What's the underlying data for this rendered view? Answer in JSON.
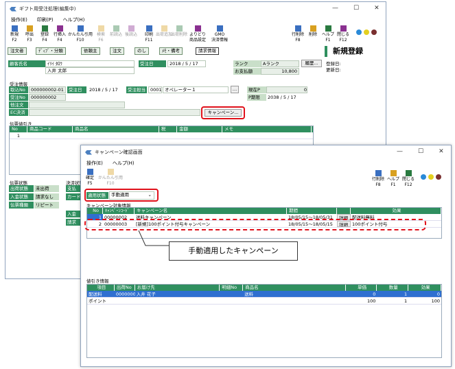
{
  "main": {
    "title": "ギフト用受注処理(編集中)",
    "menu": [
      "操作(E)",
      "印刷(P)",
      "ヘルプ(H)"
    ],
    "toolbar": [
      {
        "label": "新規",
        "key": "F2",
        "icon": "new-icon"
      },
      {
        "label": "呼出",
        "key": "F3",
        "icon": "open-icon"
      },
      {
        "label": "登録",
        "key": "F4",
        "icon": "save-icon"
      },
      {
        "label": "行挿入",
        "key": "F4",
        "icon": "row-insert-icon"
      },
      {
        "label": "かんたん引用",
        "key": "F10",
        "icon": "quote-icon"
      },
      {
        "label": "検索",
        "key": "F6",
        "icon": "search-icon"
      },
      {
        "label": "前読込",
        "key": "",
        "icon": "prev-icon"
      },
      {
        "label": "後読込",
        "key": "",
        "icon": "next-icon"
      },
      {
        "label": "印刷",
        "key": "F11",
        "icon": "print-icon"
      },
      {
        "label": "出荷追加",
        "key": "",
        "icon": "ship-add-icon"
      },
      {
        "label": "出荷削除",
        "key": "",
        "icon": "ship-delete-icon"
      },
      {
        "label": "よりどり",
        "key": "商品設定",
        "icon": "yoridori-icon"
      },
      {
        "label": "GMO",
        "key": "決済情報",
        "icon": "gmo-icon"
      }
    ],
    "toolbar_right": [
      {
        "label": "行削除",
        "key": "F8"
      },
      {
        "label": "削除",
        "key": ""
      },
      {
        "label": "ヘルプ",
        "key": "F1"
      },
      {
        "label": "閉じる",
        "key": "F12"
      }
    ],
    "tabs": [
      "注文者",
      "ﾃﾞｨﾌﾞ・分類",
      "依頼主",
      "注文",
      "のし",
      "ﾒﾓ・備考",
      "請求情報"
    ],
    "mode": "新規登録",
    "reg_date_label": "登録日:",
    "upd_date_label": "更新日:",
    "customer_label": "顧客氏名",
    "customer_kana": "ｲﾘｲ ﾀﾛｳ",
    "customer_name": "入井 太郎",
    "order_date_label": "受注日",
    "order_date": "2018 / 5 / 17",
    "rank_label": "ランク",
    "rank_value": "Aランク",
    "history_btn": "履歴...",
    "paid_label": "お支払額",
    "paid_value": "10,800",
    "section_order": "受注情報",
    "order_no_label": "取込No",
    "order_no": "000000002-01",
    "order_date2_label": "受注日",
    "order_date2": "2018 / 5 / 17",
    "staff_label": "受注担当",
    "staff_code": "0001",
    "staff_name": "オペレーター１",
    "current_p_label": "現在P",
    "current_p": "0",
    "order_no2_label": "受注No",
    "order_no2": "000000002",
    "p_expire_label": "P期限",
    "p_expire": "2038 / 5 / 17",
    "other_order_label": "他注文",
    "ec_label": "EC決済",
    "campaign_btn": "キャンペーン...",
    "section_slip": "伝票値引き",
    "slip_cols": [
      "No",
      "商品コード",
      "商品名",
      "税",
      "金額",
      "メモ"
    ],
    "slip_row1_no": "1",
    "status_left": [
      "伝票状態",
      "出荷状態",
      "入金状態",
      "伝票種類"
    ],
    "status_vals": [
      "未出荷",
      "請求なし",
      "リピート"
    ],
    "payment_label": "決済状態",
    "payment_items": [
      "支払",
      "カード",
      "入金",
      "請求"
    ]
  },
  "dialog": {
    "title": "キャンペーン確認画面",
    "menu": [
      "操作(E)",
      "ヘルプ(H)"
    ],
    "toolbar": [
      {
        "label": "確定",
        "key": "F5"
      },
      {
        "label": "かんたん引用",
        "key": "F10"
      }
    ],
    "toolbar_right": [
      {
        "label": "行削除",
        "key": "F8"
      },
      {
        "label": "ヘルプ",
        "key": "F1"
      },
      {
        "label": "閉じる",
        "key": "F12"
      }
    ],
    "apply_label": "適用状態",
    "apply_value": "手動適用",
    "campaign_section": "キャンペーン対象情報",
    "campaign_cols": [
      "No",
      "ｷｬﾝﾍﾟｰﾝｺｰﾄﾞ",
      "キャンペーン名",
      "期間",
      "",
      "効果"
    ],
    "campaign_rows": [
      {
        "no": "1",
        "code": "00000002",
        "name": "送料キャンペーン",
        "period": "18/05/15～18/05/31",
        "detail": "詳細",
        "effect": "配送料無料"
      },
      {
        "no": "2",
        "code": "00000003",
        "name": "[新規]100ポイント付与キャンペーン",
        "period": "18/05/15～18/05/15",
        "detail": "詳細",
        "effect": "100ポイント付与"
      }
    ],
    "callout": "手動適用したキャンペーン",
    "discount_section": "値引き情報",
    "discount_cols": [
      "項目",
      "出荷No",
      "お届け先",
      "明細No",
      "商品名",
      "単価",
      "数量",
      "効果"
    ],
    "discount_rows": [
      {
        "item": "配送料",
        "ship": "000000002",
        "dest": "入井 花子",
        "detail": "",
        "product": "送料",
        "price": "0",
        "qty": "1",
        "effect": "0"
      },
      {
        "item": "ポイント",
        "ship": "",
        "dest": "",
        "detail": "",
        "product": "",
        "price": "100",
        "qty": "1",
        "effect": "100"
      }
    ]
  },
  "colors": {
    "accent_green": "#2f8f5f",
    "highlight_red": "#e0101a",
    "selection_blue": "#2f6fd0"
  }
}
